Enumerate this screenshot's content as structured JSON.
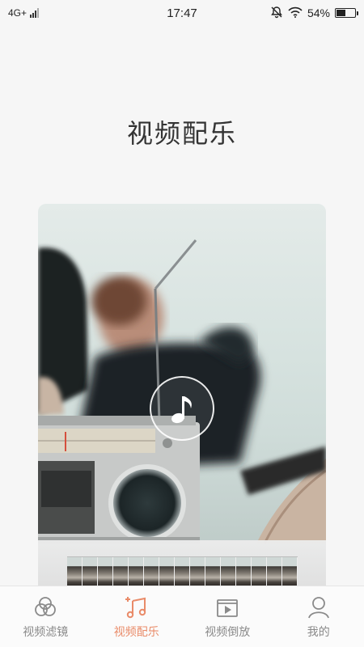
{
  "status_bar": {
    "network": "4G+",
    "time": "17:47",
    "battery": "54%",
    "battery_level": 0.54
  },
  "page": {
    "title": "视频配乐"
  },
  "tabs": [
    {
      "label": "视频滤镜",
      "icon": "filter-circles-icon",
      "active": false
    },
    {
      "label": "视频配乐",
      "icon": "music-note-icon",
      "active": true
    },
    {
      "label": "视频倒放",
      "icon": "video-play-icon",
      "active": false
    },
    {
      "label": "我的",
      "icon": "user-icon",
      "active": false
    }
  ],
  "colors": {
    "accent": "#e98b69",
    "inactive": "#8a8a8a",
    "background": "#f6f6f6"
  },
  "filmstrip": {
    "frame_count": 15
  }
}
